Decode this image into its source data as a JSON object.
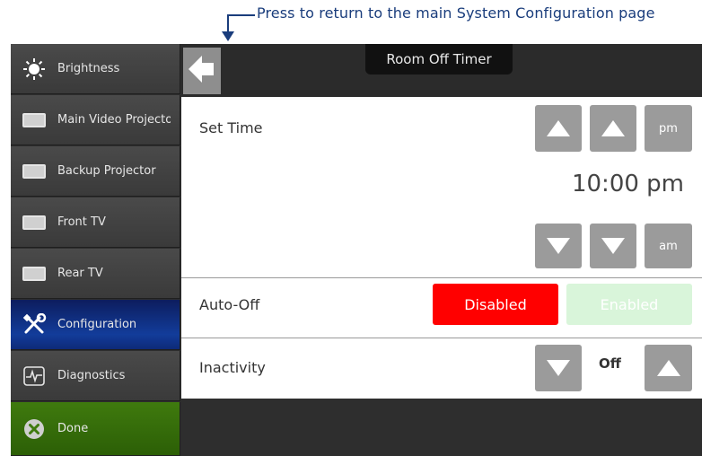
{
  "callout": {
    "text": "Press to return to the main System Configuration page"
  },
  "header": {
    "title": "Room Off Timer"
  },
  "sidebar": {
    "items": [
      {
        "label": "Brightness",
        "icon": "sun-icon"
      },
      {
        "label": "Main Video Projector",
        "icon": "display-icon"
      },
      {
        "label": "Backup Projector",
        "icon": "display-icon"
      },
      {
        "label": "Front TV",
        "icon": "display-icon"
      },
      {
        "label": "Rear TV",
        "icon": "display-icon"
      },
      {
        "label": "Configuration",
        "icon": "tools-icon",
        "active": true
      },
      {
        "label": "Diagnostics",
        "icon": "pulse-icon"
      },
      {
        "label": "Done",
        "icon": "close-circle-icon"
      }
    ]
  },
  "set_time": {
    "label": "Set Time",
    "time_value": "10:00 pm",
    "pm_label": "pm",
    "am_label": "am"
  },
  "auto_off": {
    "label": "Auto-Off",
    "disabled_label": "Disabled",
    "enabled_label": "Enabled",
    "selected": "Disabled"
  },
  "inactivity": {
    "label": "Inactivity",
    "value": "Off"
  },
  "colors": {
    "accent_active": "#123c9a",
    "done_green": "#3f7a0e",
    "disabled_red": "#ff0000",
    "enabled_faded": "#d9f5da",
    "button_gray": "#9b9b9b"
  }
}
